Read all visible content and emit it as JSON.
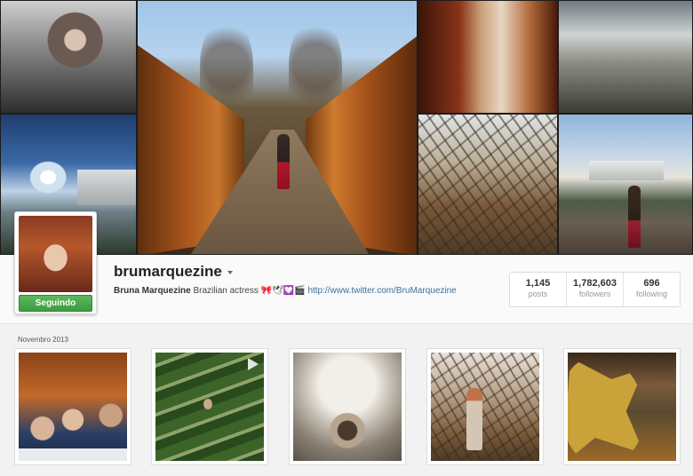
{
  "profile": {
    "username": "brumarquezine",
    "full_name": "Bruna Marquezine",
    "bio": "Brazilian actress 🎀🕊💟🎬",
    "website": "http://www.twitter.com/BruMarquezine",
    "follow_button": "Seguindo"
  },
  "stats": [
    {
      "value": "1,145",
      "label": "posts"
    },
    {
      "value": "1,782,603",
      "label": "followers"
    },
    {
      "value": "696",
      "label": "following"
    }
  ],
  "feed": {
    "month_label": "Novembro 2013"
  },
  "colors": {
    "link": "#3f729b",
    "follow_green": "#4cae4c",
    "background": "#f2f2f2"
  },
  "icons": [
    "caret-down-icon",
    "play-icon"
  ]
}
